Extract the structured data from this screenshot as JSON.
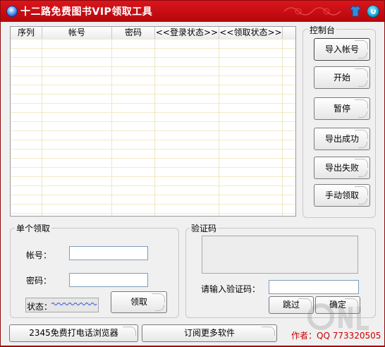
{
  "window": {
    "title": "十二路免费图书VIP领取工具",
    "icons": {
      "app": "globe-icon",
      "skin": "tshirt-skin-icon",
      "close": "power-close-icon"
    },
    "colors": {
      "titlebar": "#c00b10",
      "author_text": "#cc0000"
    }
  },
  "table": {
    "columns": [
      "序列",
      "帐号",
      "密码",
      "<<登录状态>>",
      "<<领取状态>>"
    ],
    "rows": []
  },
  "control": {
    "group_label": "控制台",
    "buttons": [
      "导入帐号",
      "开始",
      "暂停",
      "导出成功",
      "导出失败",
      "手动领取"
    ]
  },
  "single": {
    "group_label": "单个领取",
    "account_label": "帐号：",
    "account_value": "",
    "password_label": "密码：",
    "password_value": "",
    "status_label": "状态：",
    "claim_button": "领取"
  },
  "verify": {
    "group_label": "验证码",
    "input_label": "请输入验证码：",
    "input_value": "",
    "skip_button": "跳过",
    "confirm_button": "确定"
  },
  "footer": {
    "browser_button": "2345免费打电话浏览器",
    "subscribe_button": "订阅更多软件",
    "author_text": "作者：QQ 773320505"
  }
}
